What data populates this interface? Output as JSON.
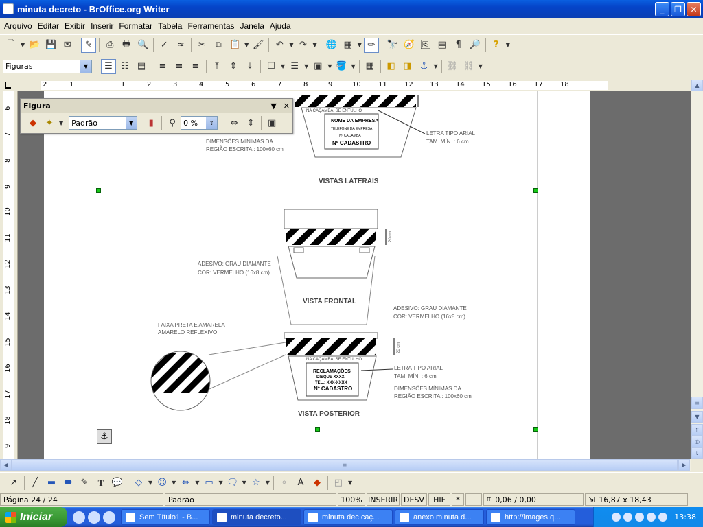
{
  "window": {
    "title": "minuta decreto - BrOffice.org Writer",
    "buttons": [
      "minimize",
      "maximize",
      "close"
    ]
  },
  "menu": [
    "Arquivo",
    "Editar",
    "Exibir",
    "Inserir",
    "Formatar",
    "Tabela",
    "Ferramentas",
    "Janela",
    "Ajuda"
  ],
  "toolbar2": {
    "style_combo": "Figuras"
  },
  "ruler_h": [
    "2",
    "1",
    "1",
    "2",
    "3",
    "4",
    "5",
    "6",
    "7",
    "8",
    "9",
    "10",
    "11",
    "12",
    "13",
    "14",
    "15",
    "16",
    "17",
    "18"
  ],
  "ruler_v": [
    "6",
    "7",
    "8",
    "9",
    "10",
    "11",
    "12",
    "13",
    "14",
    "15",
    "16",
    "17",
    "18",
    "9"
  ],
  "figure_toolbar": {
    "title": "Figura",
    "filter_value": "Padrão",
    "transparency_value": "0 %"
  },
  "drawing": {
    "top_center_label1": "NA CAÇAMBA, SE ENTULHO",
    "top_plate_line1": "NOME DA EMPRESA",
    "top_plate_line2": "TELEFONE DA EMPRESA",
    "top_plate_line3": "Nº CAÇAMBA",
    "top_plate_line4": "Nº CADASTRO",
    "top_note_left1": "DIMENSÕES MÍNIMAS DA",
    "top_note_left2": "REGIÃO ESCRITA : 100x60 cm",
    "top_note_right1": "LETRA TIPO ARIAL",
    "top_note_right2": "TAM. MÍN. : 6 cm",
    "vistas_laterais": "VISTAS LATERAIS",
    "adesivo_left1": "ADESIVO: GRAU DIAMANTE",
    "adesivo_left2": "COR: VERMELHO (16x8 cm)",
    "vista_frontal": "VISTA FRONTAL",
    "adesivo_right1": "ADESIVO: GRAU DIAMANTE",
    "adesivo_right2": "COR: VERMELHO (16x8 cm)",
    "faixa1": "FAIXA PRETA E AMARELA",
    "faixa2": "AMARELO REFLEXIVO",
    "bottom_center_label1": "NA CAÇAMBA, SE ENTULHO",
    "bottom_plate_line1": "RECLAMAÇÕES",
    "bottom_plate_line2": "DISQUE XXXX",
    "bottom_plate_line3": "TEL.: XXX-XXXX",
    "bottom_plate_line4": "Nº CADASTRO",
    "bottom_note_right1": "LETRA TIPO ARIAL",
    "bottom_note_right2": "TAM. MÍN. : 6 cm",
    "bottom_note_right3": "DIMENSÕES MÍNIMAS DA",
    "bottom_note_right4": "REGIÃO ESCRITA : 100x60 cm",
    "vista_posterior": "VISTA POSTERIOR",
    "dim_label": "20 cm"
  },
  "status": {
    "page": "Página 24 / 24",
    "style": "Padrão",
    "zoom": "100%",
    "insert_mode": "INSERIR",
    "selection_mode": "DESV",
    "hyphen": "HIF",
    "modified": "*",
    "position": "0,06 / 0,00",
    "size": "16,87 x 18,43"
  },
  "taskbar": {
    "start": "Iniciar",
    "tasks": [
      {
        "label": "Sem Título1 - B...",
        "active": false
      },
      {
        "label": "minuta decreto...",
        "active": true
      },
      {
        "label": "minuta dec caç...",
        "active": false
      },
      {
        "label": "anexo minuta d...",
        "active": false
      },
      {
        "label": "http://images.q...",
        "active": false
      }
    ],
    "clock": "13:38"
  },
  "colors": {
    "titlebar": "#0a5fe0",
    "selection_handle": "#17c817",
    "page_background": "#ffffff",
    "workspace": "#6c6c6c"
  }
}
